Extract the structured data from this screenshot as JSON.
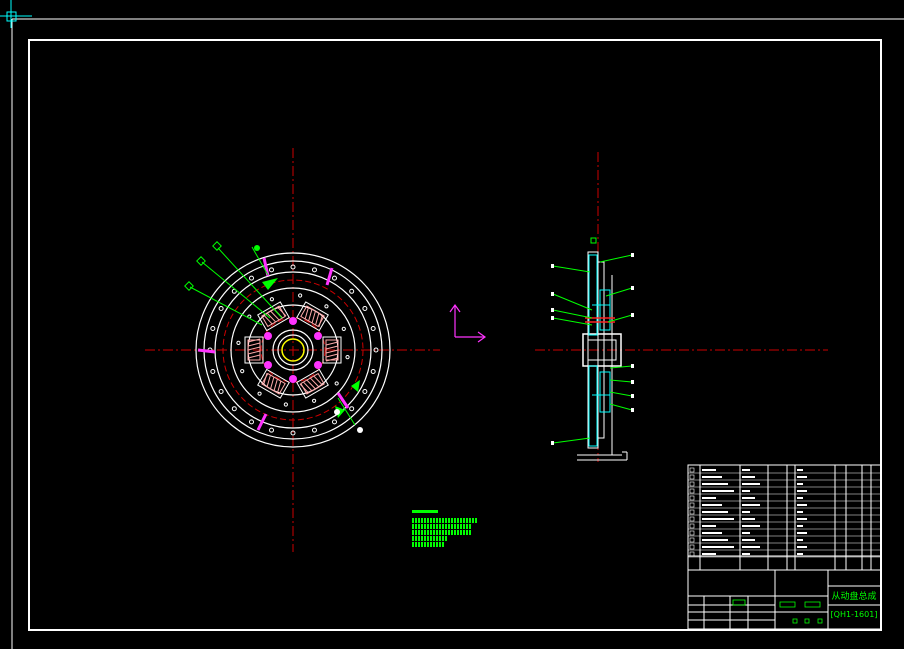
{
  "drawing": {
    "background": "#000000",
    "line_color": "#ffffff",
    "center_line_color": "#cc0000",
    "accent_green": "#00ff00",
    "accent_cyan": "#00ffff",
    "accent_magenta": "#ff33ff"
  },
  "title_block": {
    "drawing_title": "从动盘总成",
    "drawing_number": "[QH1-1601]"
  },
  "icons": {
    "ucs": "ucs-axis-icon",
    "crosshair": "crosshair-cursor-icon"
  }
}
